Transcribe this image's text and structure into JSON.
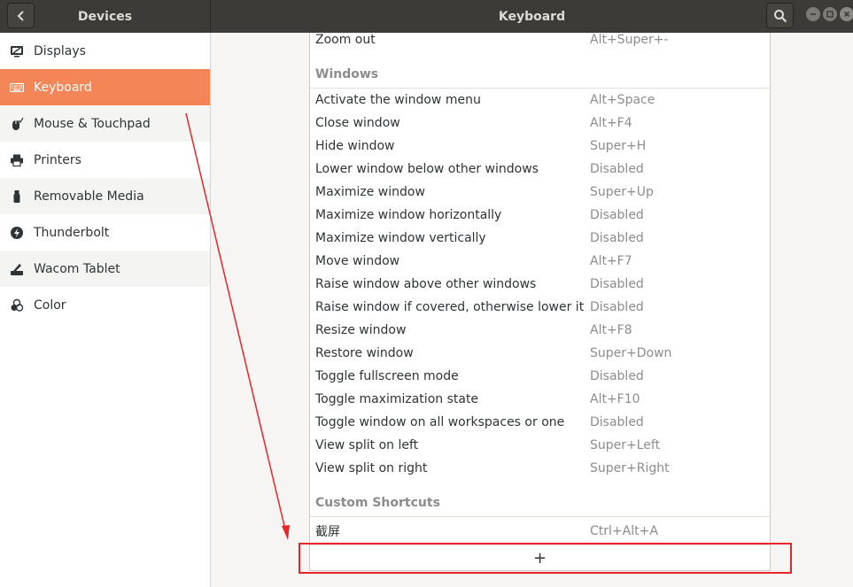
{
  "header": {
    "left_title": "Devices",
    "right_title": "Keyboard",
    "back_icon": "chevron-left-icon",
    "search_icon": "search-icon"
  },
  "sidebar": {
    "items": [
      {
        "label": "Displays",
        "icon": "display-icon"
      },
      {
        "label": "Keyboard",
        "icon": "keyboard-icon"
      },
      {
        "label": "Mouse & Touchpad",
        "icon": "mouse-icon"
      },
      {
        "label": "Printers",
        "icon": "printer-icon"
      },
      {
        "label": "Removable Media",
        "icon": "usb-drive-icon"
      },
      {
        "label": "Thunderbolt",
        "icon": "thunderbolt-icon"
      },
      {
        "label": "Wacom Tablet",
        "icon": "tablet-icon"
      },
      {
        "label": "Color",
        "icon": "color-icon"
      }
    ],
    "active_index": 1
  },
  "shortcuts": {
    "top_row": {
      "name": "Zoom out",
      "accel": "Alt+Super+-"
    },
    "windows_header": "Windows",
    "windows": [
      {
        "name": "Activate the window menu",
        "accel": "Alt+Space"
      },
      {
        "name": "Close window",
        "accel": "Alt+F4"
      },
      {
        "name": "Hide window",
        "accel": "Super+H"
      },
      {
        "name": "Lower window below other windows",
        "accel": "Disabled"
      },
      {
        "name": "Maximize window",
        "accel": "Super+Up"
      },
      {
        "name": "Maximize window horizontally",
        "accel": "Disabled"
      },
      {
        "name": "Maximize window vertically",
        "accel": "Disabled"
      },
      {
        "name": "Move window",
        "accel": "Alt+F7"
      },
      {
        "name": "Raise window above other windows",
        "accel": "Disabled"
      },
      {
        "name": "Raise window if covered, otherwise lower it",
        "accel": "Disabled"
      },
      {
        "name": "Resize window",
        "accel": "Alt+F8"
      },
      {
        "name": "Restore window",
        "accel": "Super+Down"
      },
      {
        "name": "Toggle fullscreen mode",
        "accel": "Disabled"
      },
      {
        "name": "Toggle maximization state",
        "accel": "Alt+F10"
      },
      {
        "name": "Toggle window on all workspaces or one",
        "accel": "Disabled"
      },
      {
        "name": "View split on left",
        "accel": "Super+Left"
      },
      {
        "name": "View split on right",
        "accel": "Super+Right"
      }
    ],
    "custom_header": "Custom Shortcuts",
    "custom": [
      {
        "name": "截屏",
        "accel": "Ctrl+Alt+A"
      }
    ],
    "add_label": "+"
  },
  "colors": {
    "accent": "#f48557",
    "header_bg": "#3c3b37",
    "annotation": "#e8262a"
  }
}
